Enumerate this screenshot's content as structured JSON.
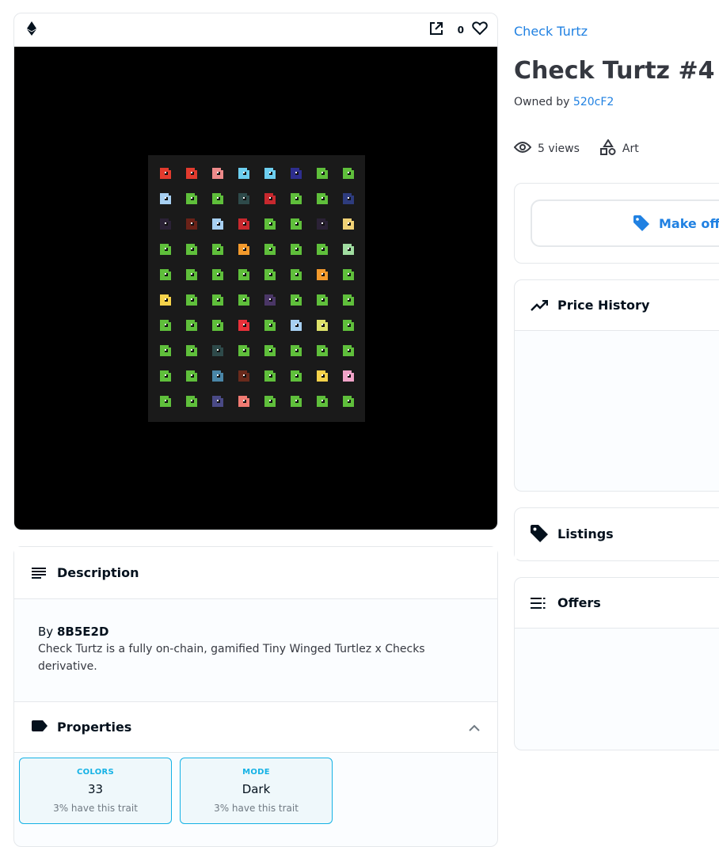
{
  "media": {
    "favorite_count": "0",
    "grid_colors": [
      [
        "#e23b2e",
        "#e23b2e",
        "#ee8a8a",
        "#6dcff0",
        "#6dcff0",
        "#2e2e8e",
        "#5fbf3b",
        "#5fbf3b"
      ],
      [
        "#a7d0f2",
        "#5fbf3b",
        "#5fbf3b",
        "#2e4a4a",
        "#c7282e",
        "#5fbf3b",
        "#5fbf3b",
        "#2e3c7e"
      ],
      [
        "#2b2236",
        "#6a2218",
        "#a7d0f2",
        "#c7282e",
        "#5fbf3b",
        "#5fbf3b",
        "#2b2236",
        "#f0d276"
      ],
      [
        "#5fbf3b",
        "#5fbf3b",
        "#5fbf3b",
        "#f39a2c",
        "#5fbf3b",
        "#5fbf3b",
        "#5fbf3b",
        "#a0dca0"
      ],
      [
        "#5fbf3b",
        "#5fbf3b",
        "#5fbf3b",
        "#5fbf3b",
        "#5fbf3b",
        "#5fbf3b",
        "#f39a2c",
        "#5fbf3b"
      ],
      [
        "#f5d24a",
        "#5fbf3b",
        "#5fbf3b",
        "#5fbf3b",
        "#4a3666",
        "#5fbf3b",
        "#5fbf3b",
        "#5fbf3b"
      ],
      [
        "#5fbf3b",
        "#5fbf3b",
        "#5fbf3b",
        "#e8303a",
        "#5fbf3b",
        "#a7d0f2",
        "#dfe36a",
        "#5fbf3b"
      ],
      [
        "#5fbf3b",
        "#5fbf3b",
        "#2e4a4a",
        "#5fbf3b",
        "#5fbf3b",
        "#5fbf3b",
        "#5fbf3b",
        "#5fbf3b"
      ],
      [
        "#5fbf3b",
        "#5fbf3b",
        "#4a86a8",
        "#6a2a1c",
        "#5fbf3b",
        "#5fbf3b",
        "#f5d24a",
        "#f0a3c8"
      ],
      [
        "#5fbf3b",
        "#5fbf3b",
        "#4a4a86",
        "#f07a72",
        "#5fbf3b",
        "#5fbf3b",
        "#5fbf3b",
        "#5fbf3b"
      ]
    ]
  },
  "description": {
    "heading": "Description",
    "by_prefix": "By",
    "creator": "8B5E2D",
    "text": "Check Turtz is a fully on-chain, gamified Tiny Winged Turtlez x Checks derivative."
  },
  "properties": {
    "heading": "Properties",
    "traits": [
      {
        "type": "COLORS",
        "value": "33",
        "rarity": "3% have this trait"
      },
      {
        "type": "MODE",
        "value": "Dark",
        "rarity": "3% have this trait"
      }
    ]
  },
  "item": {
    "collection": "Check Turtz",
    "title": "Check Turtz #4",
    "owned_by_label": "Owned by",
    "owner": "520cF2",
    "views": "5 views",
    "category": "Art"
  },
  "actions": {
    "make_offer": "Make offer"
  },
  "sections": {
    "price_history": "Price History",
    "listings": "Listings",
    "offers": "Offers"
  },
  "colors": {
    "accent": "#2081e2",
    "trait_border": "#15b2e5"
  }
}
